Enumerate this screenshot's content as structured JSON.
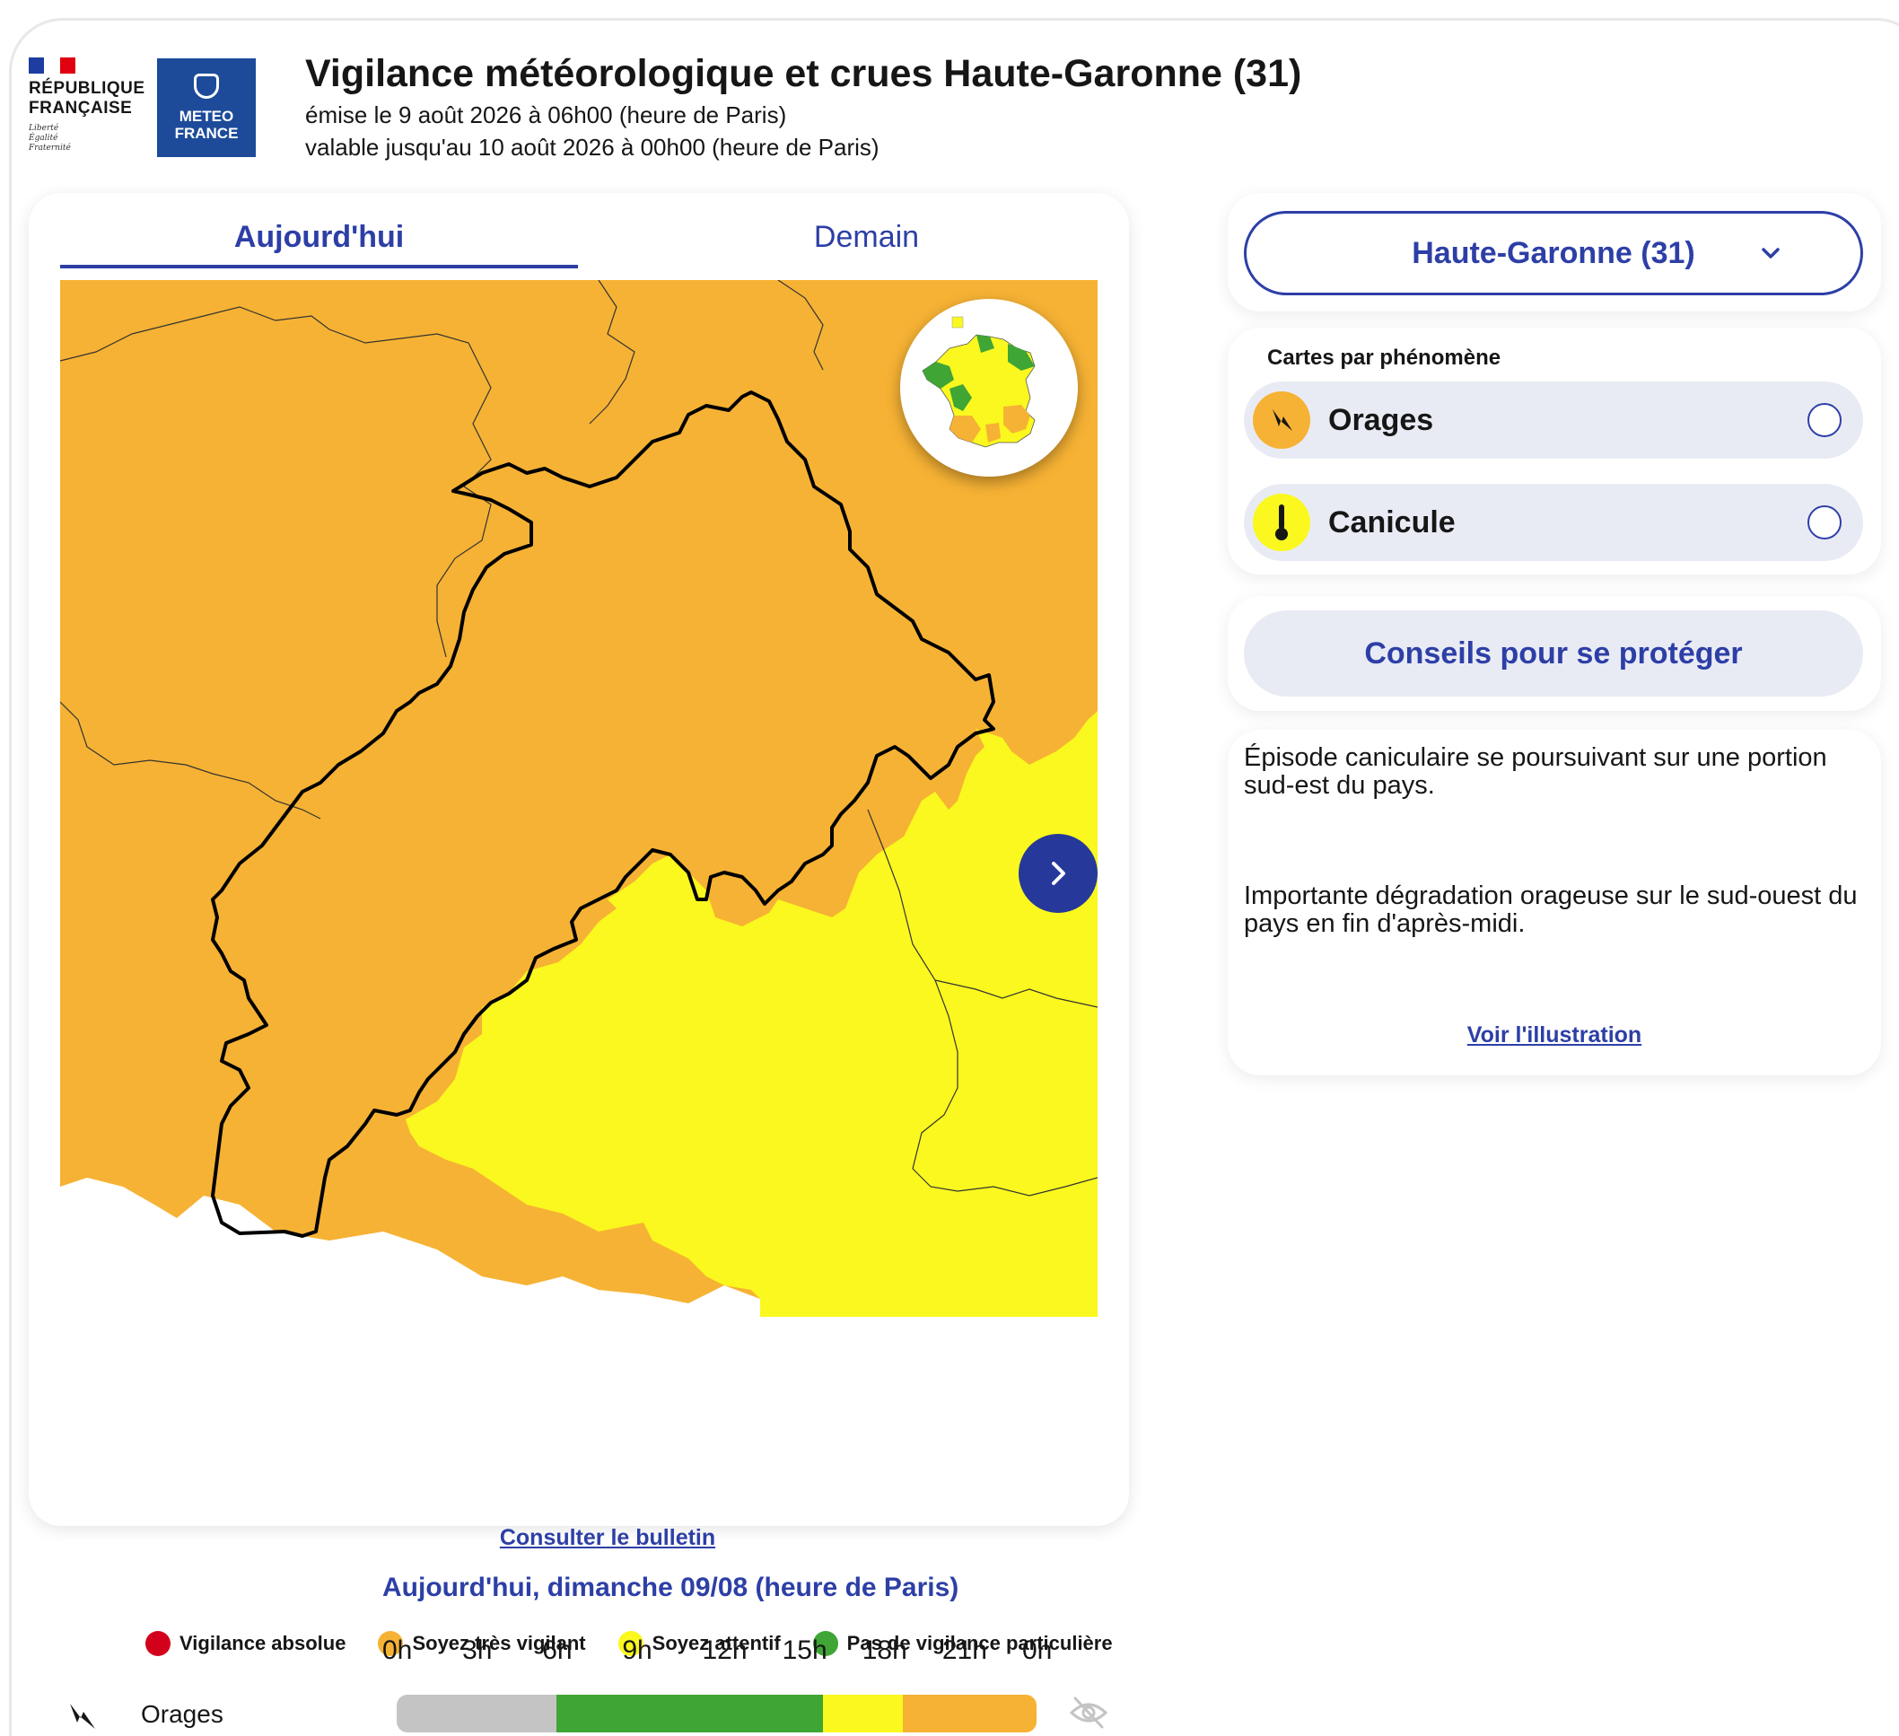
{
  "header": {
    "rf_text": "RÉPUBLIQUE FRANÇAISE",
    "rf_motto_1": "Liberté",
    "rf_motto_2": "Égalité",
    "rf_motto_3": "Fraternité",
    "mf_line1": "METEO",
    "mf_line2": "FRANCE",
    "title": "Vigilance météorologique et crues Haute-Garonne (31)",
    "issued": "émise le 9 août 2026 à 06h00 (heure de Paris)",
    "valid_until": "valable jusqu'au 10 août 2026 à 00h00 (heure de Paris)"
  },
  "tabs": [
    {
      "label": "Aujourd'hui",
      "active": true
    },
    {
      "label": "Demain",
      "active": false
    }
  ],
  "map": {
    "bulletin_link": "Consulter le bulletin"
  },
  "legend": [
    {
      "label": "Vigilance absolue",
      "color": "#d3001b"
    },
    {
      "label": "Soyez très vigilant",
      "color": "#f6b234"
    },
    {
      "label": "Soyez attentif",
      "color": "#faf81e"
    },
    {
      "label": "Pas de vigilance particulière",
      "color": "#3fa535"
    }
  ],
  "colors": {
    "orange": "#f6b234",
    "yellow": "#faf81e",
    "green": "#3fa535",
    "accent": "#2d3fa6",
    "grey": "#c4c4c4"
  },
  "department_select": {
    "value": "Haute-Garonne (31)",
    "icon": "chevron-down-icon"
  },
  "phenomena": {
    "title": "Cartes par phénomène",
    "items": [
      {
        "label": "Orages",
        "icon": "lightning-icon",
        "color": "#f6b234"
      },
      {
        "label": "Canicule",
        "icon": "thermometer-icon",
        "color": "#faf81e"
      }
    ]
  },
  "advice_button": "Conseils pour se protéger",
  "summary": {
    "paragraph1": "Épisode caniculaire se poursuivant sur une portion sud-est du pays.",
    "paragraph2": "Importante dégradation orageuse sur le sud-ouest du pays en fin d'après-midi.",
    "link": "Voir l'illustration"
  },
  "timeline": {
    "title": "Aujourd'hui, dimanche 09/08 (heure de Paris)",
    "hours": [
      "0h",
      "3h",
      "6h",
      "9h",
      "12h",
      "15h",
      "18h",
      "21h",
      "0h"
    ],
    "rows": [
      {
        "label": "Orages",
        "icon": "lightning-icon",
        "segments": [
          {
            "from_hour": 0,
            "to_hour": 6,
            "level": "none",
            "color": "#c4c4c4"
          },
          {
            "from_hour": 6,
            "to_hour": 16,
            "level": "green",
            "color": "#3fa535"
          },
          {
            "from_hour": 16,
            "to_hour": 19,
            "level": "yellow",
            "color": "#faf81e"
          },
          {
            "from_hour": 19,
            "to_hour": 24,
            "level": "orange",
            "color": "#f6b234"
          }
        ]
      }
    ]
  }
}
